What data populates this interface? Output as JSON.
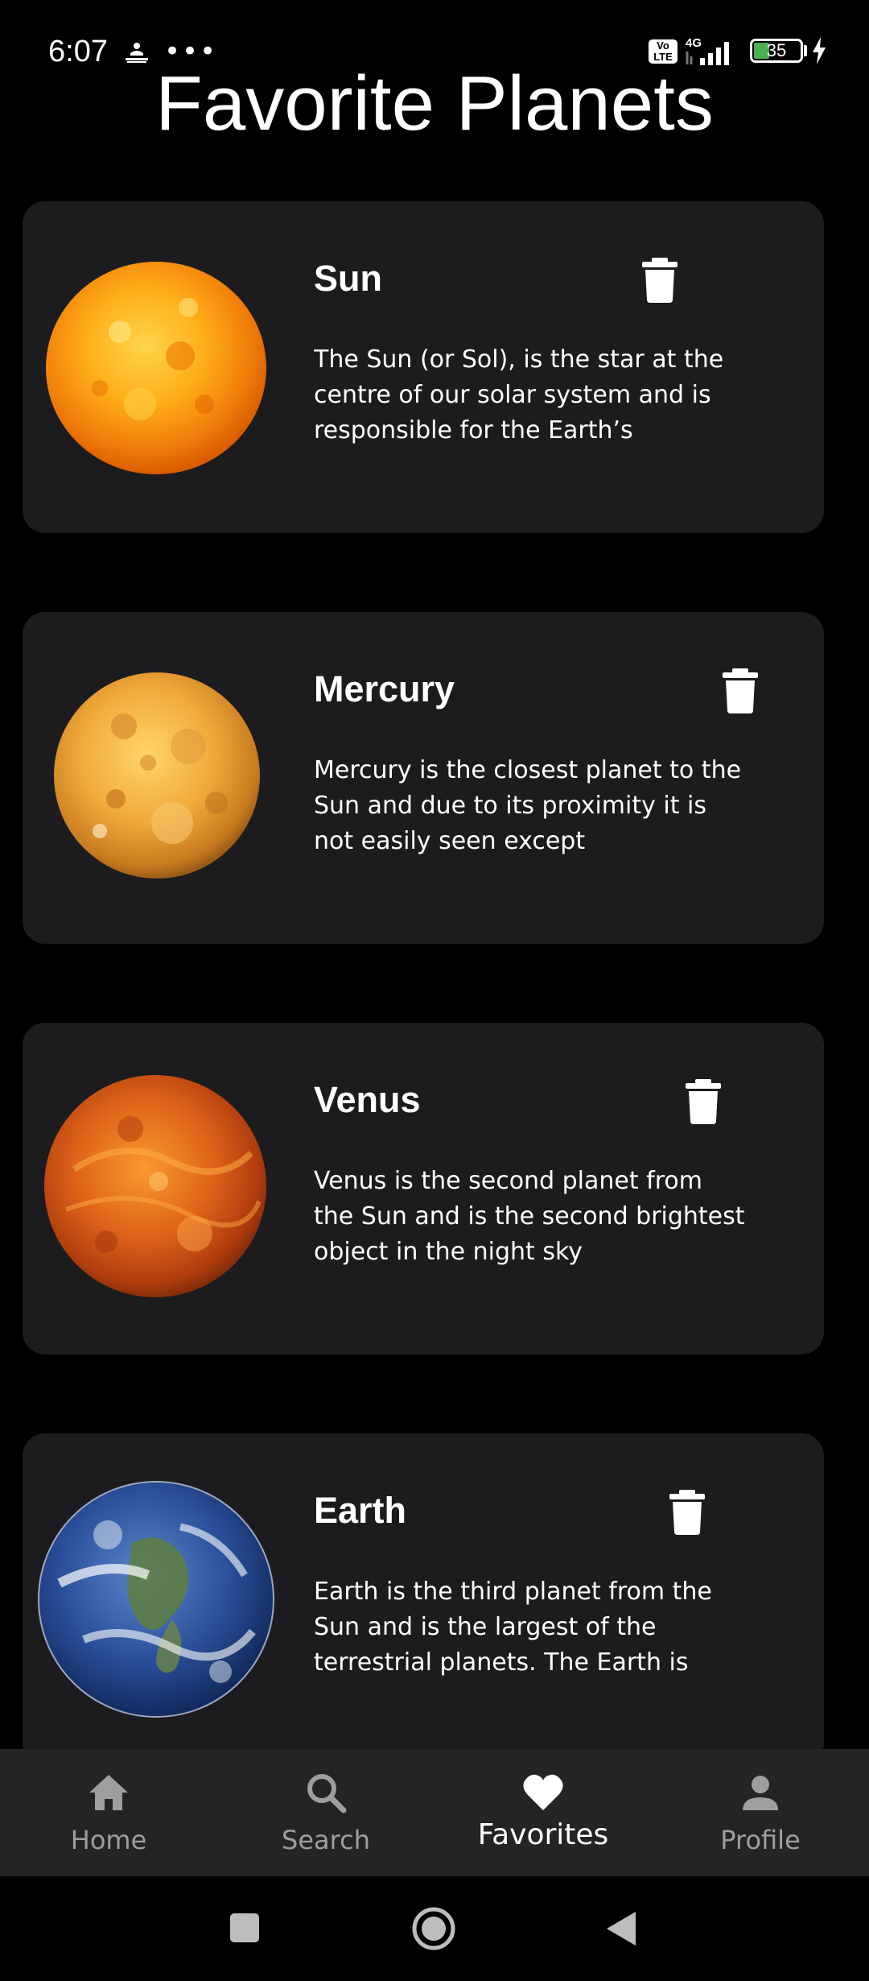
{
  "status_bar": {
    "time": "6:07",
    "dots": "•••",
    "volte": "Vo LTE",
    "network": "4G",
    "battery_level": "35",
    "battery_fraction": 0.35,
    "battery_color": "#4caf50"
  },
  "page": {
    "title": "Favorite Planets"
  },
  "planets": [
    {
      "name": "Sun",
      "description": "The Sun (or Sol), is the star at the centre of our solar system and is responsible for the Earth’s",
      "image_icon": "sun-image"
    },
    {
      "name": "Mercury",
      "description": "Mercury is the closest planet to the Sun and due to its proximity it is not easily seen except",
      "image_icon": "mercury-image"
    },
    {
      "name": "Venus",
      "description": "Venus is the second planet from the Sun and is the second brightest object in the night sky",
      "image_icon": "venus-image"
    },
    {
      "name": "Earth",
      "description": "Earth is the third planet from the Sun and is the largest of the terrestrial planets. The Earth is",
      "image_icon": "earth-image"
    }
  ],
  "bottom_nav": {
    "items": [
      {
        "label": "Home",
        "icon": "home-icon",
        "active": false
      },
      {
        "label": "Search",
        "icon": "search-icon",
        "active": false
      },
      {
        "label": "Favorites",
        "icon": "heart-icon",
        "active": true
      },
      {
        "label": "Profile",
        "icon": "person-icon",
        "active": false
      }
    ]
  },
  "system_nav": {
    "buttons": [
      "recents-button",
      "home-button",
      "back-button"
    ]
  },
  "colors": {
    "background": "#000000",
    "card": "#1c1c1e",
    "nav_background": "#242424",
    "inactive": "#9e9e9e",
    "active": "#ffffff"
  }
}
